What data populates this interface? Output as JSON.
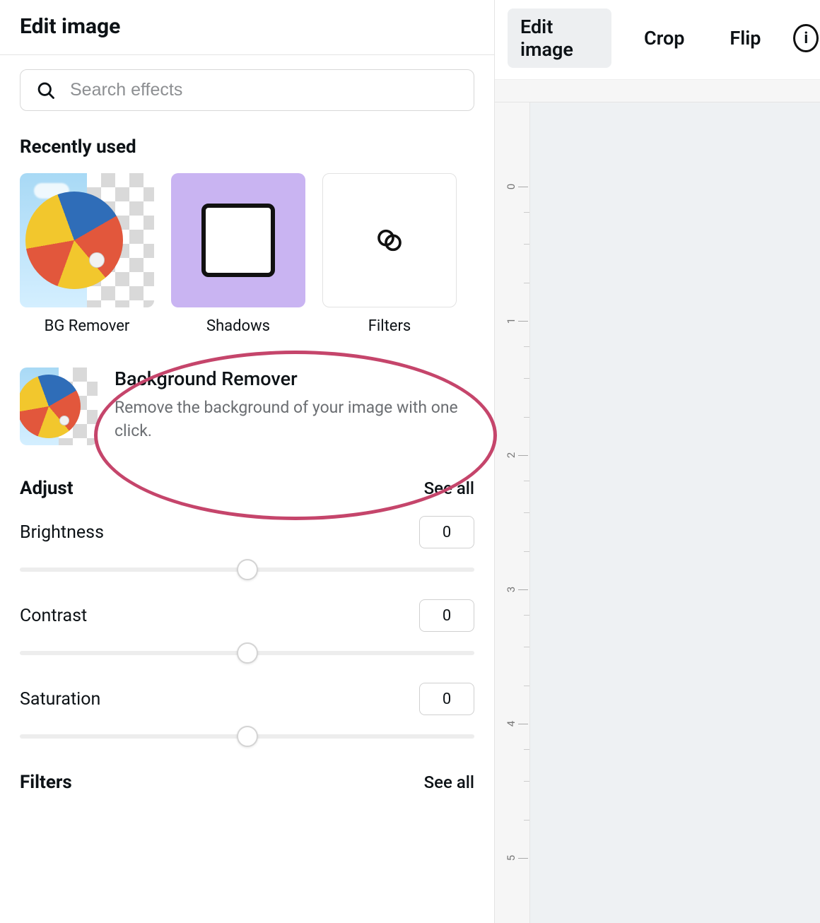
{
  "panel": {
    "title": "Edit image",
    "search": {
      "placeholder": "Search effects",
      "value": ""
    }
  },
  "recently_used": {
    "title": "Recently used",
    "items": [
      {
        "label": "BG Remover",
        "icon": "bg-remover-icon"
      },
      {
        "label": "Shadows",
        "icon": "shadows-icon"
      },
      {
        "label": "Filters",
        "icon": "filters-icon"
      }
    ]
  },
  "bg_remover": {
    "title": "Background Remover",
    "description": "Remove the background of your image with one click."
  },
  "adjust": {
    "title": "Adjust",
    "see_all": "See all",
    "items": [
      {
        "label": "Brightness",
        "value": "0"
      },
      {
        "label": "Contrast",
        "value": "0"
      },
      {
        "label": "Saturation",
        "value": "0"
      }
    ]
  },
  "filters_section": {
    "title": "Filters",
    "see_all": "See all"
  },
  "toolbar": {
    "tabs": [
      {
        "label": "Edit image",
        "active": true
      },
      {
        "label": "Crop",
        "active": false
      },
      {
        "label": "Flip",
        "active": false
      }
    ]
  },
  "ruler": {
    "ticks": [
      "0",
      "1",
      "2",
      "3",
      "4",
      "5"
    ]
  },
  "annotation": {
    "highlight": "background-remover-row"
  }
}
